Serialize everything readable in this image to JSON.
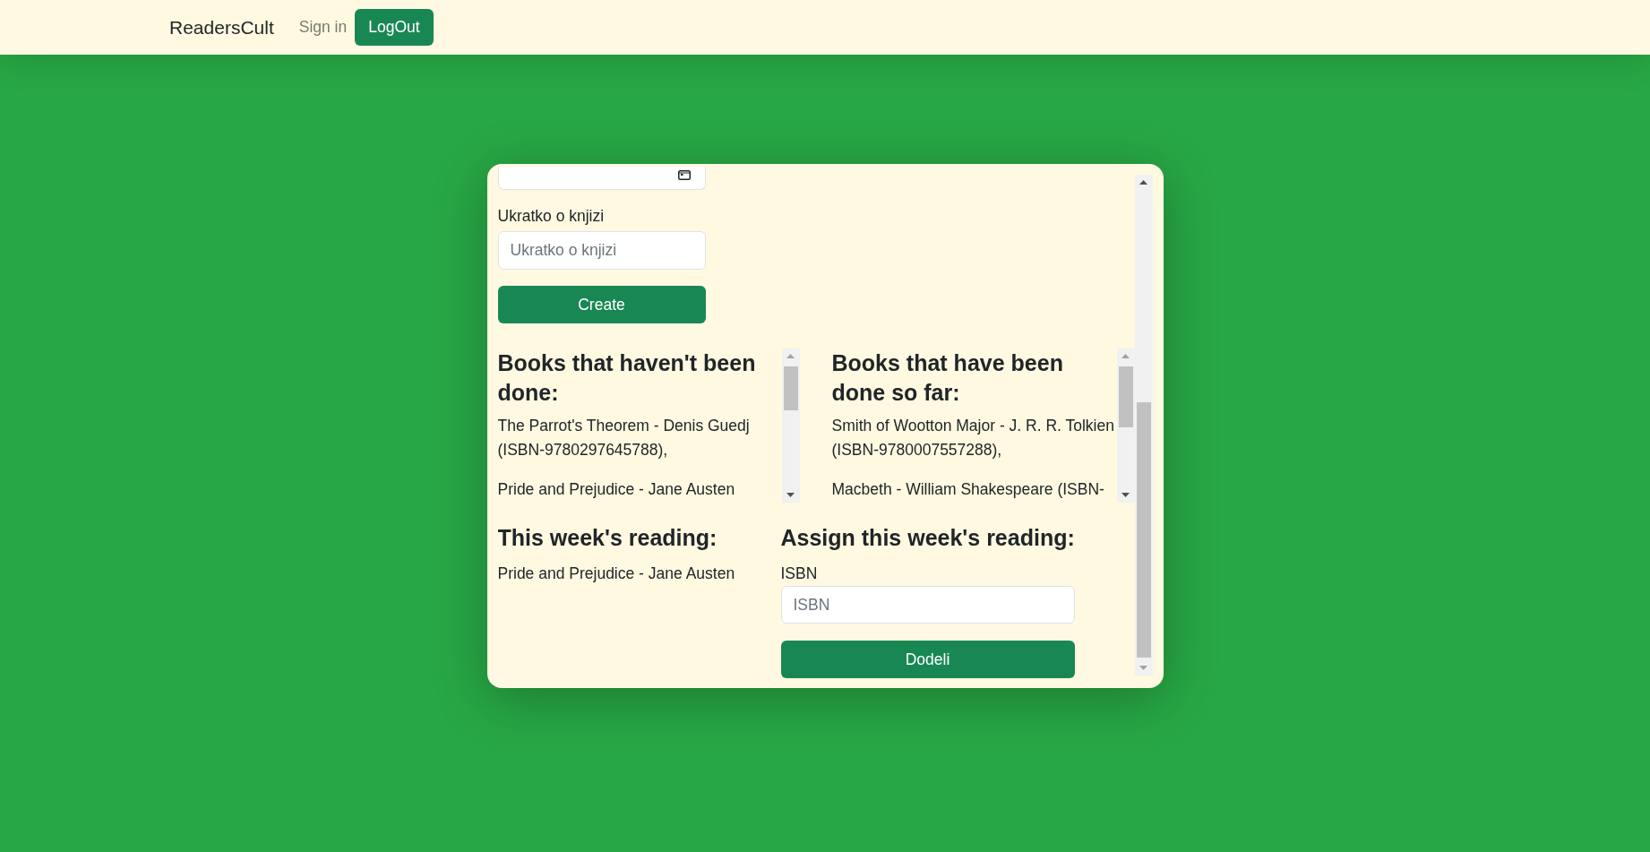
{
  "navbar": {
    "brand": "ReadersCult",
    "links": [
      "Sign in"
    ],
    "button": "LogOut"
  },
  "book_form": {
    "fields": [
      {
        "kind": "date"
      },
      {
        "kind": "text",
        "label": "Ukratko o knjizi",
        "placeholder": "Ukratko o knjizi"
      }
    ],
    "submit": "Create"
  },
  "book_lists": [
    {
      "title": "Books that haven't been done:",
      "items": [
        "The Parrot's Theorem - Denis Guedj (ISBN-9780297645788),",
        "Pride and Prejudice - Jane Austen"
      ]
    },
    {
      "title": "Books that have been done so far:",
      "items": [
        "Smith of Wootton Major - J. R. R. Tolkien (ISBN-9780007557288),",
        "Macbeth - William Shakespeare (ISBN-"
      ]
    }
  ],
  "weekly_reading": {
    "title": "This week's reading:",
    "book": "Pride and Prejudice - Jane Austen"
  },
  "assign_form": {
    "title": "Assign this week's reading:",
    "label": "ISBN",
    "placeholder": "ISBN",
    "submit": "Dodeli"
  }
}
